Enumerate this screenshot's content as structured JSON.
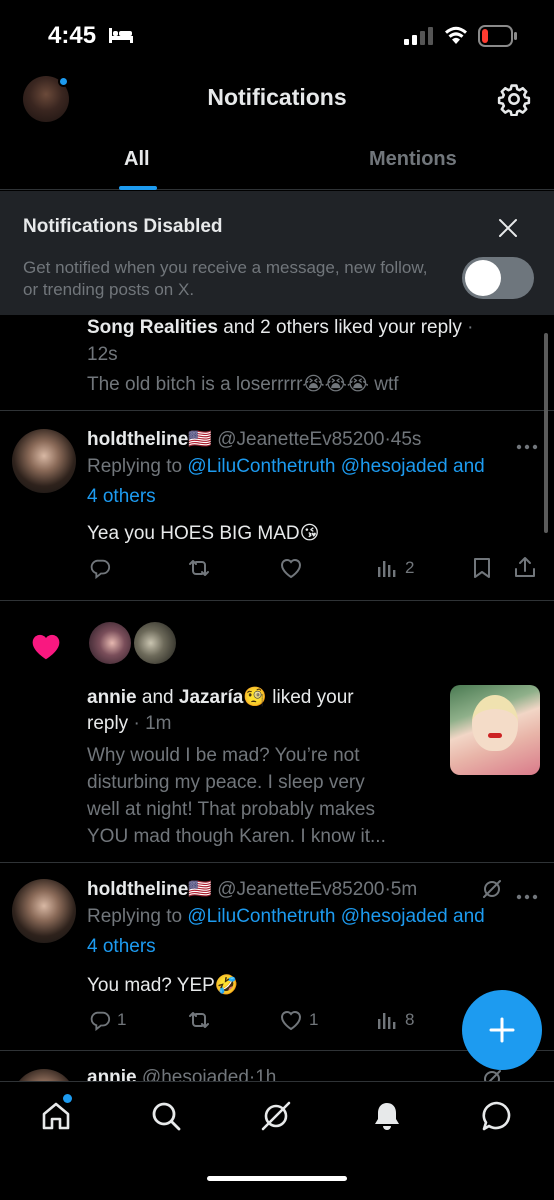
{
  "status_bar": {
    "time": "4:45"
  },
  "header": {
    "title": "Notifications",
    "tabs": [
      {
        "label": "All"
      },
      {
        "label": "Mentions"
      }
    ]
  },
  "banner": {
    "title": "Notifications Disabled",
    "text": "Get notified when you receive a message, new follow, or trending posts on X.",
    "toggle_on": false
  },
  "notifications": [
    {
      "actor": "Song Realities",
      "rest": " and 2 others liked your reply",
      "dot": " ·",
      "time": "12s",
      "preview": "The old bitch is a loserrrrr😭😭😭 wtf"
    },
    {
      "name": "holdtheline🇺🇸",
      "handle": "@JeanetteEv85200",
      "time": "·45s",
      "replying_prefix": "Replying to ",
      "mentions": "@LiluConthetruth @hesojaded and",
      "mentions_2": "4 others",
      "body": "Yea you HOES BIG MAD😘",
      "stats": {
        "replies": "",
        "reposts": "",
        "likes": "",
        "views": "2"
      }
    },
    {
      "actor1": "annie",
      "and": " and ",
      "actor2": "Jazaría🧐",
      "rest": " liked your",
      "line2": "reply",
      "time": " · 1m",
      "preview": [
        "Why would I be mad? You’re not",
        "disturbing my peace. I sleep very",
        "well at night! That probably makes",
        "YOU mad though Karen. I know it..."
      ]
    },
    {
      "name": "holdtheline🇺🇸",
      "handle": "@JeanetteEv85200",
      "time": "·5m",
      "replying_prefix": "Replying to ",
      "mentions": "@LiluConthetruth @hesojaded and",
      "mentions_2": "4 others",
      "body": "You mad? YEP🤣",
      "stats": {
        "replies": "1",
        "reposts": "",
        "likes": "1",
        "views": "8"
      }
    },
    {
      "name": "annie",
      "handle": "@hesojaded",
      "time": "·1h"
    }
  ],
  "icons": {
    "status": [
      "bed-icon",
      "signal-icon",
      "wifi-icon",
      "battery-icon"
    ],
    "header": [
      "gear-icon"
    ],
    "actions": [
      "reply-icon",
      "repost-icon",
      "like-icon",
      "views-icon",
      "bookmark-icon",
      "share-icon"
    ],
    "nav": [
      "home-icon",
      "search-icon",
      "grok-icon",
      "notifications-bell-icon",
      "messages-icon"
    ]
  },
  "colors": {
    "accent": "#1d9bf0",
    "like": "#f91880",
    "muted": "#71767b",
    "battery_low": "#ff3b30"
  }
}
